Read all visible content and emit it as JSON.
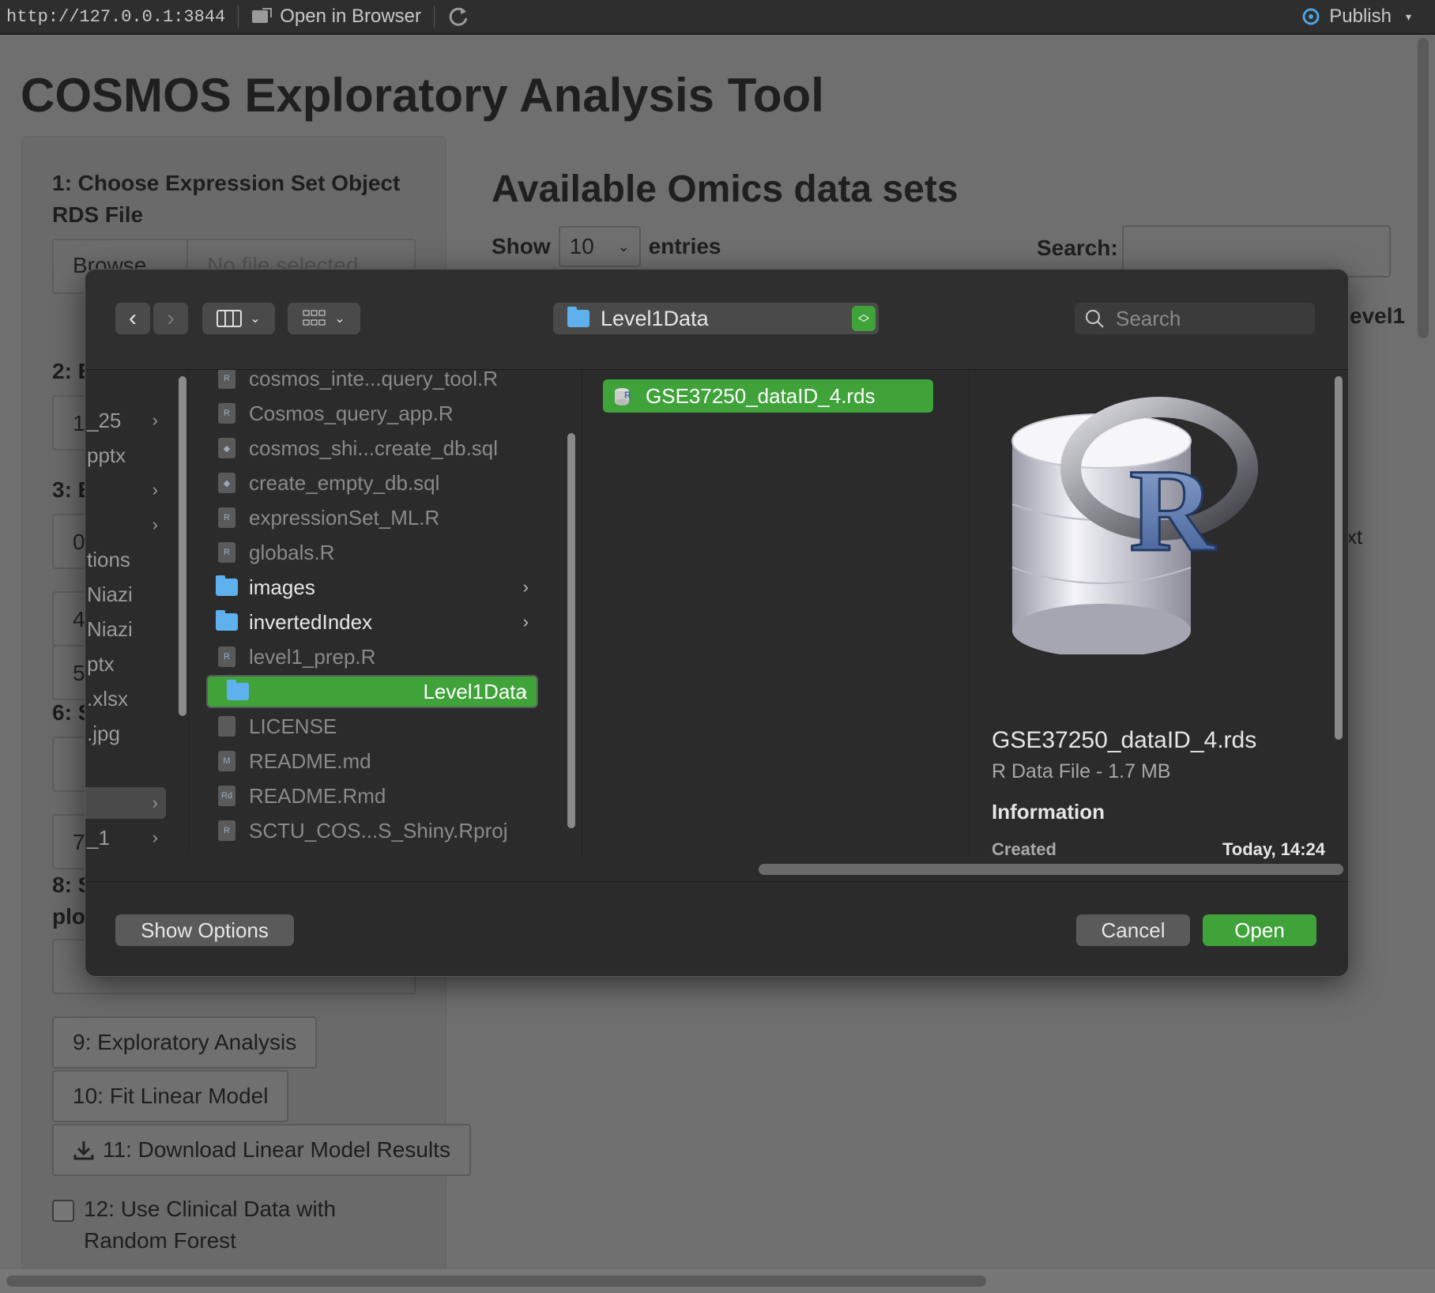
{
  "browser_bar": {
    "url": "http://127.0.0.1:3844",
    "open_in_browser": "Open in Browser",
    "publish": "Publish"
  },
  "app": {
    "title": "COSMOS Exploratory Analysis Tool",
    "steps": {
      "step1": "1: Choose Expression Set Object",
      "step1b": "RDS File",
      "browse": "Browse...",
      "no_file": "No file selected",
      "step2": "2: E",
      "step3": "3: E",
      "step6": "6: S",
      "step8": "8: S",
      "step8b": "plo",
      "b1": "1",
      "b0": "0",
      "b4": "4",
      "b5": "5",
      "b7": "7"
    },
    "buttons": {
      "exploratory": "9: Exploratory Analysis",
      "fit_linear": "10: Fit Linear Model",
      "download": "11: Download Linear Model Results",
      "clinical_a": "12: Use Clinical Data with",
      "clinical_b": "Random Forest"
    },
    "main": {
      "heading": "Available Omics data sets",
      "show": "Show",
      "entries_value": "10",
      "entries": "entries",
      "search": "Search:",
      "level1": "evel1",
      "xt": "xt"
    }
  },
  "dialog": {
    "path": "Level1Data",
    "search_placeholder": "Search",
    "left_col": [
      "_25",
      "pptx",
      "",
      "",
      "tions",
      "Niazi",
      "Niazi",
      "ptx",
      ".xlsx",
      ".jpg",
      "",
      "",
      "_1"
    ],
    "files": [
      {
        "name": "cosmos_inte...query_tool.R",
        "type": "r"
      },
      {
        "name": "Cosmos_query_app.R",
        "type": "r"
      },
      {
        "name": "cosmos_shi...create_db.sql",
        "type": "sql"
      },
      {
        "name": "create_empty_db.sql",
        "type": "sql"
      },
      {
        "name": "expressionSet_ML.R",
        "type": "r"
      },
      {
        "name": "globals.R",
        "type": "r"
      },
      {
        "name": "images",
        "type": "folder"
      },
      {
        "name": "invertedIndex",
        "type": "folder"
      },
      {
        "name": "level1_prep.R",
        "type": "r"
      },
      {
        "name": "Level1Data",
        "type": "folder-selected"
      },
      {
        "name": "LICENSE",
        "type": "doc"
      },
      {
        "name": "README.md",
        "type": "md"
      },
      {
        "name": "README.Rmd",
        "type": "rmd"
      },
      {
        "name": "SCTU_COS...S_Shiny.Rproj",
        "type": "rproj"
      }
    ],
    "selected_file": "GSE37250_dataID_4.rds",
    "preview": {
      "name": "GSE37250_dataID_4.rds",
      "kind": "R Data File - 1.7 MB",
      "info_heading": "Information",
      "created_label": "Created",
      "created_value": "Today, 14:24"
    },
    "buttons": {
      "show_options": "Show Options",
      "cancel": "Cancel",
      "open": "Open"
    },
    "colors": {
      "accent": "#3fa33a",
      "folder": "#5eb1ec"
    }
  }
}
